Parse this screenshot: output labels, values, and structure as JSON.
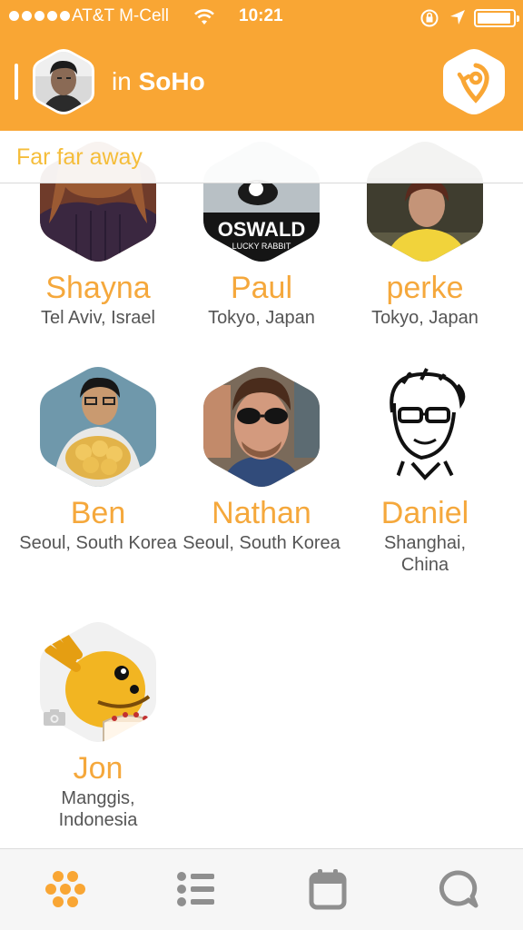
{
  "status_bar": {
    "carrier": "AT&T M-Cell",
    "time": "10:21"
  },
  "nav": {
    "prefix": "in",
    "place": "SoHo"
  },
  "section": {
    "title": "Far far away"
  },
  "people": [
    {
      "name": "Shayna",
      "location": "Tel Aviv, Israel"
    },
    {
      "name": "Paul",
      "location": "Tokyo, Japan"
    },
    {
      "name": "perke",
      "location": "Tokyo, Japan"
    },
    {
      "name": "Ben",
      "location": "Seoul, South Korea"
    },
    {
      "name": "Nathan",
      "location": "Seoul, South Korea"
    },
    {
      "name": "Daniel",
      "location": "Shanghai, China"
    },
    {
      "name": "Jon",
      "location": "Manggis, Indonesia"
    }
  ],
  "avatar_images": {
    "paul_text_1": "OSWALD",
    "paul_text_2": "LUCKY RABBIT"
  },
  "tabs": [
    {
      "icon": "hexagon-grid-icon"
    },
    {
      "icon": "list-icon"
    },
    {
      "icon": "calendar-icon"
    },
    {
      "icon": "chat-bubble-icon"
    }
  ],
  "colors": {
    "accent": "#f9a634",
    "name": "#f5a83c",
    "section_title": "#f5bd3a",
    "tab_active": "#f9a634",
    "tab_inactive": "#8f8f8f"
  }
}
